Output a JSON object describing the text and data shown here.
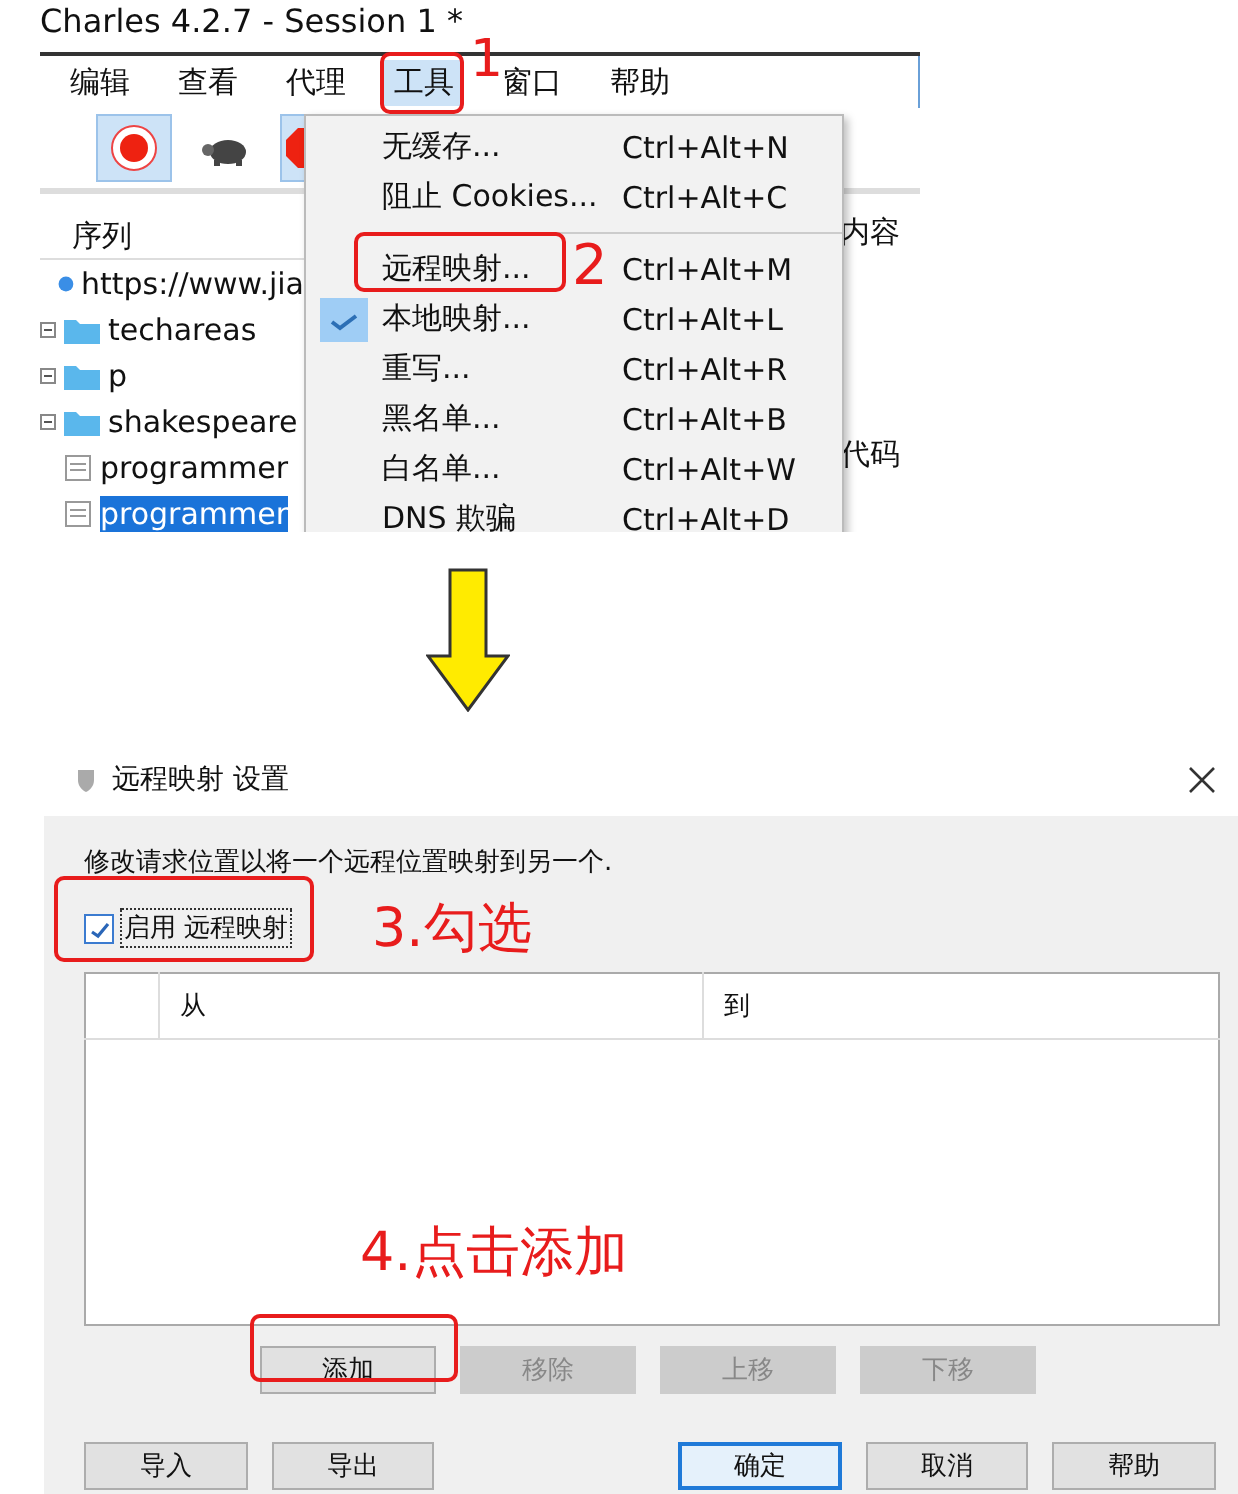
{
  "app": {
    "title": "Charles 4.2.7 - Session 1 *",
    "menus": [
      {
        "label": "编辑",
        "selected": false
      },
      {
        "label": "查看",
        "selected": false
      },
      {
        "label": "代理",
        "selected": false
      },
      {
        "label": "工具",
        "selected": true
      },
      {
        "label": "窗口",
        "selected": false
      },
      {
        "label": "帮助",
        "selected": false
      }
    ],
    "columns": [
      "序列",
      "内容"
    ],
    "tree": [
      {
        "label": "https://www.jia",
        "kind": "host",
        "selected": false
      },
      {
        "label": "techareas",
        "kind": "folder",
        "selected": false
      },
      {
        "label": "p",
        "kind": "folder",
        "selected": false
      },
      {
        "label": "shakespeare",
        "kind": "folder",
        "selected": false
      },
      {
        "label": "programmer",
        "kind": "file",
        "selected": false
      },
      {
        "label": "programmer",
        "kind": "file",
        "selected": true
      }
    ],
    "side_text": "代码",
    "tools_menu": [
      {
        "kind": "item",
        "label": "无缓存...",
        "shortcut": "Ctrl+Alt+N",
        "checked": false
      },
      {
        "kind": "item",
        "label": "阻止 Cookies...",
        "shortcut": "Ctrl+Alt+C",
        "checked": false
      },
      {
        "kind": "separator"
      },
      {
        "kind": "item",
        "label": "远程映射...",
        "shortcut": "Ctrl+Alt+M",
        "checked": false
      },
      {
        "kind": "item",
        "label": "本地映射...",
        "shortcut": "Ctrl+Alt+L",
        "checked": true
      },
      {
        "kind": "item",
        "label": "重写...",
        "shortcut": "Ctrl+Alt+R",
        "checked": false
      },
      {
        "kind": "item",
        "label": "黑名单...",
        "shortcut": "Ctrl+Alt+B",
        "checked": false
      },
      {
        "kind": "item",
        "label": "白名单...",
        "shortcut": "Ctrl+Alt+W",
        "checked": false
      },
      {
        "kind": "item",
        "label": "DNS 欺骗",
        "shortcut": "Ctrl+Alt+D",
        "checked": false
      }
    ]
  },
  "dialog": {
    "title": "远程映射 设置",
    "description": "修改请求位置以将一个远程位置映射到另一个.",
    "enable": {
      "label": "启用 远程映射",
      "checked": true
    },
    "table": {
      "columns": [
        "从",
        "到"
      ]
    },
    "list_buttons": [
      {
        "label": "添加",
        "disabled": false
      },
      {
        "label": "移除",
        "disabled": true
      },
      {
        "label": "上移",
        "disabled": true
      },
      {
        "label": "下移",
        "disabled": true
      }
    ],
    "buttons": [
      {
        "label": "导入",
        "default": false
      },
      {
        "label": "导出",
        "default": false
      },
      {
        "label": "确定",
        "default": true
      },
      {
        "label": "取消",
        "default": false
      },
      {
        "label": "帮助",
        "default": false
      }
    ]
  },
  "annotations": [
    {
      "text": "1"
    },
    {
      "text": "2"
    },
    {
      "text": "3.勾选"
    },
    {
      "text": "4.点击添加"
    }
  ]
}
